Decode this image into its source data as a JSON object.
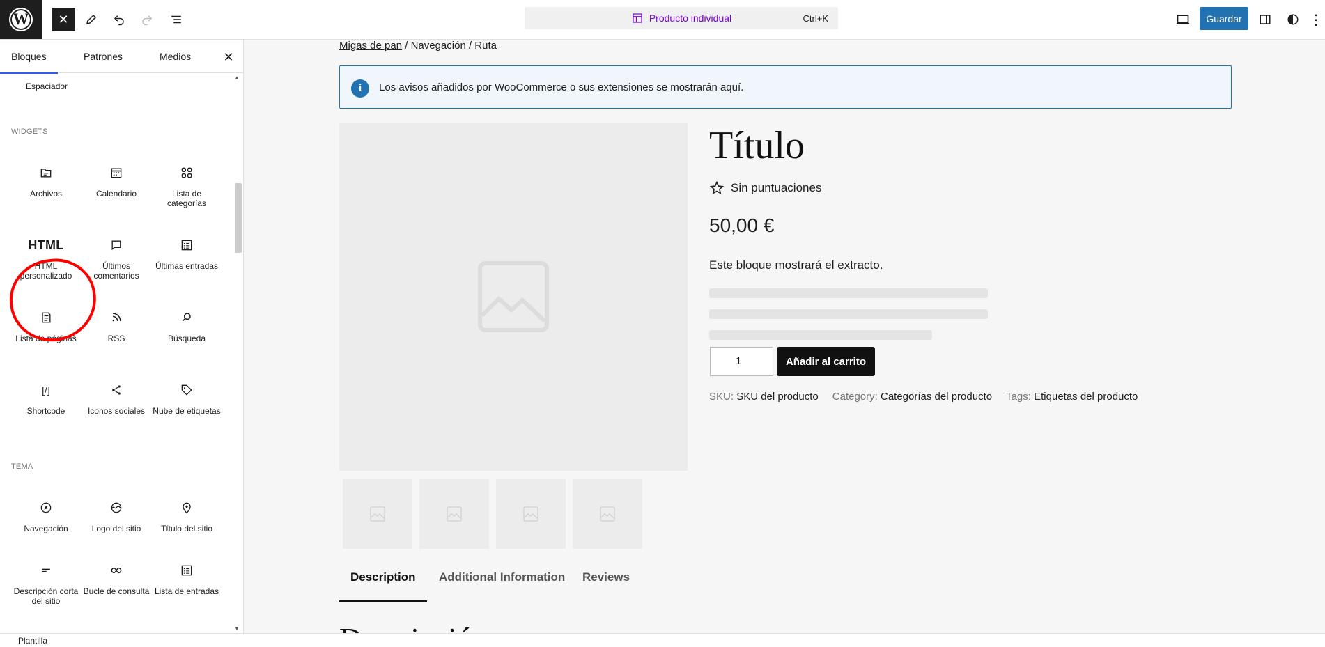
{
  "topbar": {
    "logo_letter": "W",
    "command_label": "Producto individual",
    "command_shortcut": "Ctrl+K",
    "save_label": "Guardar"
  },
  "sidebar": {
    "tabs": [
      "Bloques",
      "Patrones",
      "Medios"
    ],
    "spacer_label": "Espaciador",
    "widgets_heading": "WIDGETS",
    "theme_heading": "TEMA",
    "widgets": [
      {
        "label": "Archivos"
      },
      {
        "label": "Calendario"
      },
      {
        "label": "Lista de categorías"
      },
      {
        "label": "HTML personalizado",
        "icon_text": "HTML"
      },
      {
        "label": "Últimos comentarios"
      },
      {
        "label": "Últimas entradas"
      },
      {
        "label": "Lista de páginas"
      },
      {
        "label": "RSS"
      },
      {
        "label": "Búsqueda"
      },
      {
        "label": "Shortcode",
        "icon_text": "[/]"
      },
      {
        "label": "Iconos sociales"
      },
      {
        "label": "Nube de etiquetas"
      }
    ],
    "theme": [
      {
        "label": "Navegación"
      },
      {
        "label": "Logo del sitio"
      },
      {
        "label": "Título del sitio"
      },
      {
        "label": "Descripción corta del sitio"
      },
      {
        "label": "Bucle de consulta"
      },
      {
        "label": "Lista de entradas"
      }
    ]
  },
  "statusbar": {
    "label": "Plantilla"
  },
  "canvas": {
    "breadcrumb_link": "Migas de pan",
    "breadcrumb_rest": " / Navegación / Ruta",
    "notice_icon": "i",
    "notice": "Los avisos añadidos por WooCommerce o sus extensiones se mostrarán aquí.",
    "product_title": "Título",
    "rating_text": "Sin puntuaciones",
    "price": "50,00 €",
    "excerpt": "Este bloque mostrará el extracto.",
    "quantity": "1",
    "add_to_cart": "Añadir al carrito",
    "meta": {
      "sku_key": "SKU:",
      "sku_val": "SKU del producto",
      "cat_key": "Category:",
      "cat_val": "Categorías del producto",
      "tags_key": "Tags:",
      "tags_val": "Etiquetas del producto"
    },
    "tabs": [
      "Description",
      "Additional Information",
      "Reviews"
    ],
    "desc_heading_partial": "Descripción"
  }
}
